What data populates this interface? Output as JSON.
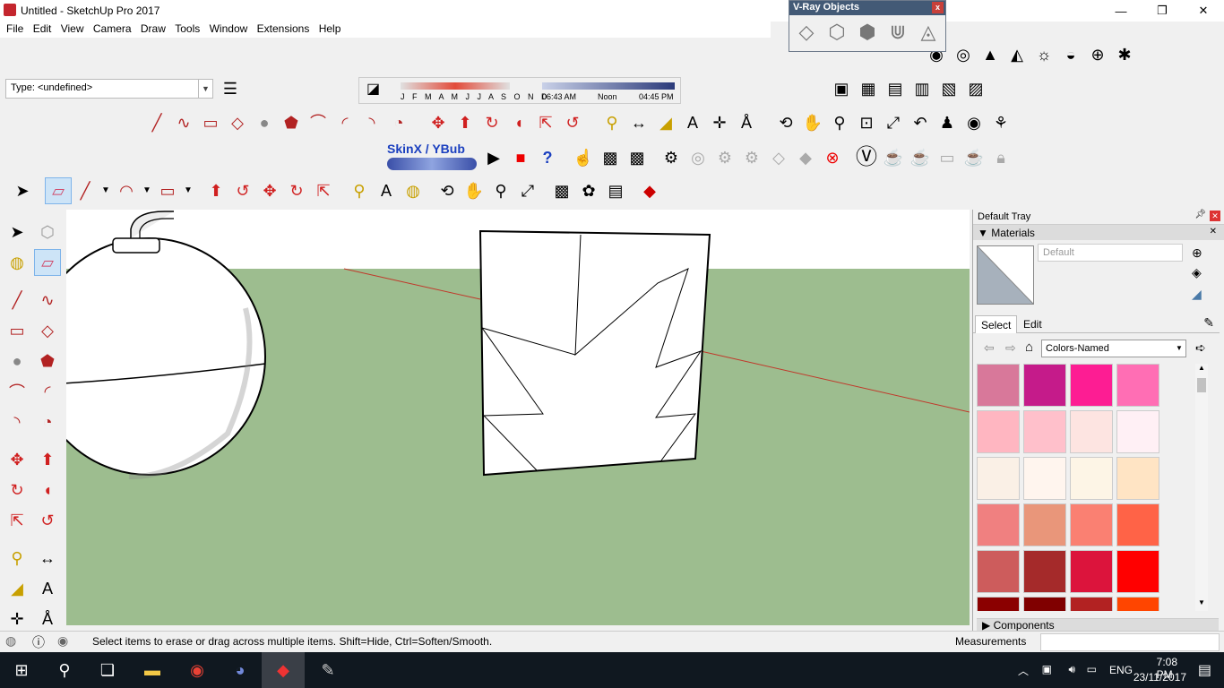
{
  "window": {
    "title": "Untitled - SketchUp Pro 2017",
    "minimize": "—",
    "maximize": "❐",
    "close": "✕"
  },
  "menu": [
    "File",
    "Edit",
    "View",
    "Camera",
    "Draw",
    "Tools",
    "Window",
    "Extensions",
    "Help"
  ],
  "vray": {
    "title": "V-Ray Objects",
    "close": "x"
  },
  "type_field": {
    "value": "Type: <undefined>"
  },
  "shadows": {
    "months": "J F M A M J J A S O N D",
    "time_start": "06:43 AM",
    "time_mid": "Noon",
    "time_end": "04:45 PM"
  },
  "plugin_label": "SkinX / YBub",
  "tray": {
    "title": "Default Tray",
    "materials_header": "Materials",
    "material_name": "Default",
    "tab_select": "Select",
    "tab_edit": "Edit",
    "collection": "Colors-Named",
    "components_header": "Components",
    "swatch_colors": [
      "#d8789a",
      "#c51b8a",
      "#fd1d93",
      "#ff6eb4",
      "#ffb6c1",
      "#ffc0cb",
      "#fde4e1",
      "#fff0f5",
      "#faf0e6",
      "#fff5ee",
      "#fdf5e6",
      "#ffe4c4",
      "#f08080",
      "#e9967a",
      "#fa8072",
      "#ff6347",
      "#cd5c5c",
      "#a52a2a",
      "#dc143c",
      "#ff0000",
      "#8b0000",
      "#800000",
      "#b22222",
      "#ff4500"
    ]
  },
  "status": {
    "message": "Select items to erase or drag across multiple items. Shift=Hide, Ctrl=Soften/Smooth.",
    "measurements_label": "Measurements"
  },
  "taskbar": {
    "time": "7:08 PM",
    "date": "23/11/2017",
    "language": "ENG"
  },
  "colors": {
    "ground": "#9dbd8f",
    "sky": "#ffffff",
    "red_axis": "#c0392b",
    "vray_title_bg": "#435a76"
  }
}
